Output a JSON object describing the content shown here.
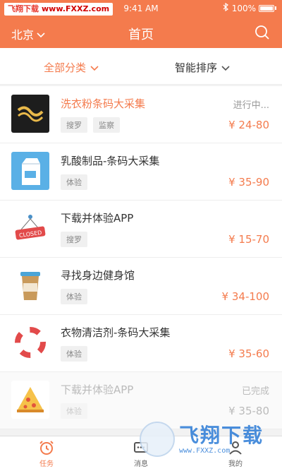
{
  "status_bar": {
    "watermark_label": "飞翔下载",
    "watermark_url": "www.FXXZ.com",
    "time": "9:41 AM",
    "bluetooth": "bluetooth-icon",
    "battery": "100%"
  },
  "header": {
    "city": "北京",
    "title": "首页"
  },
  "filters": {
    "category": "全部分类",
    "sort": "智能排序"
  },
  "tasks": [
    {
      "title": "洗衣粉条码大采集",
      "tags": [
        "搜罗",
        "监察"
      ],
      "status": "进行中...",
      "price": "¥ 24-80",
      "icon": "detergent-logo-icon"
    },
    {
      "title": "乳酸制品-条码大采集",
      "tags": [
        "体验"
      ],
      "status": "",
      "price": "¥ 35-90",
      "icon": "milk-carton-icon"
    },
    {
      "title": "下载并体验APP",
      "tags": [
        "搜罗"
      ],
      "status": "",
      "price": "¥ 15-70",
      "icon": "closed-sign-icon"
    },
    {
      "title": "寻找身边健身馆",
      "tags": [
        "体验"
      ],
      "status": "",
      "price": "¥ 34-100",
      "icon": "coffee-cup-icon"
    },
    {
      "title": "衣物清洁剂-条码大采集",
      "tags": [
        "体验"
      ],
      "status": "",
      "price": "¥ 35-60",
      "icon": "lifebuoy-icon"
    },
    {
      "title": "下载并体验APP",
      "tags": [
        "体验"
      ],
      "status": "已完成",
      "price": "¥ 35-80",
      "icon": "pizza-icon"
    }
  ],
  "tabbar": {
    "tab1": "任务",
    "tab2": "消息",
    "tab3": "我的"
  },
  "watermark": {
    "text": "飞翔下载",
    "url": "www.FXXZ.com"
  },
  "colors": {
    "accent": "#f47b4d"
  }
}
